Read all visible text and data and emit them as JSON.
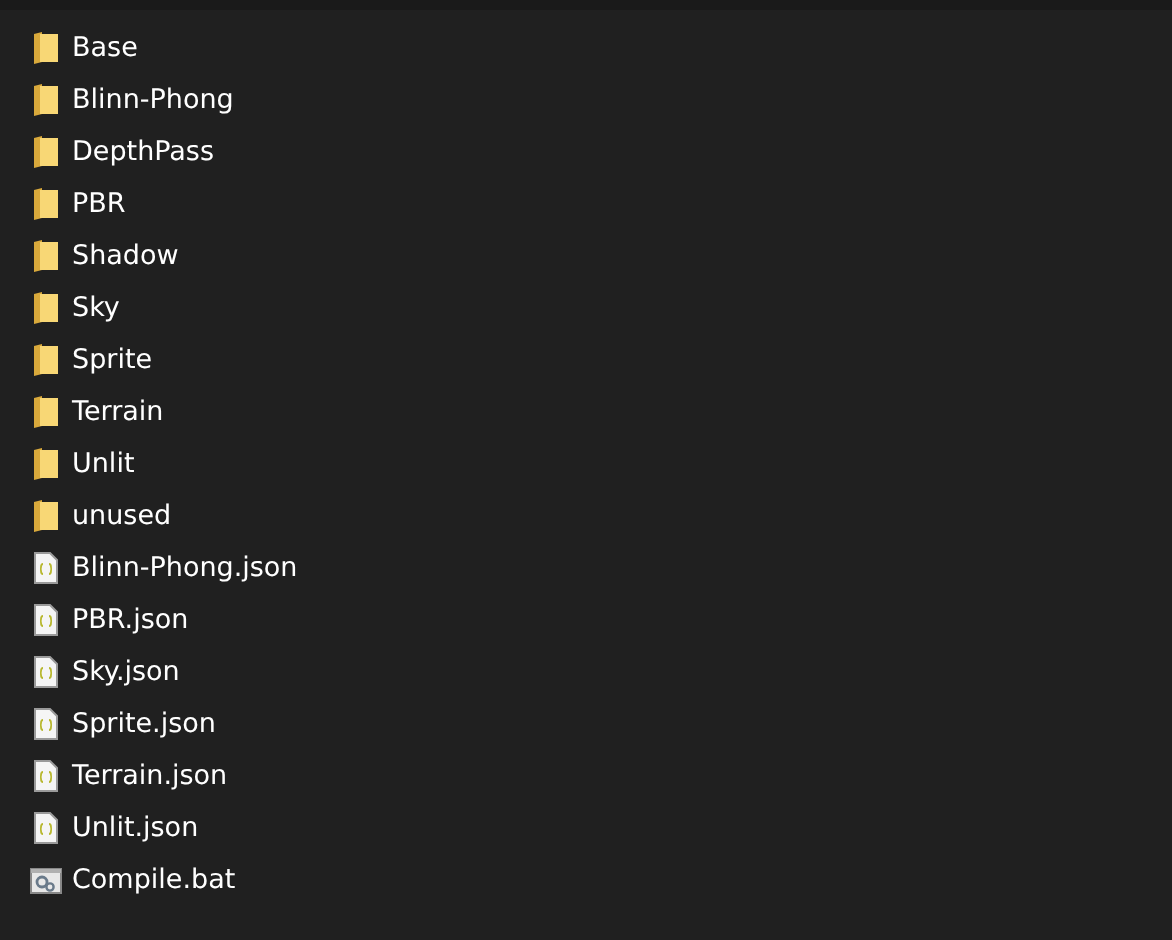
{
  "items": [
    {
      "name": "Base",
      "kind": "folder"
    },
    {
      "name": "Blinn-Phong",
      "kind": "folder"
    },
    {
      "name": "DepthPass",
      "kind": "folder"
    },
    {
      "name": "PBR",
      "kind": "folder"
    },
    {
      "name": "Shadow",
      "kind": "folder"
    },
    {
      "name": "Sky",
      "kind": "folder"
    },
    {
      "name": "Sprite",
      "kind": "folder"
    },
    {
      "name": "Terrain",
      "kind": "folder"
    },
    {
      "name": "Unlit",
      "kind": "folder"
    },
    {
      "name": "unused",
      "kind": "folder"
    },
    {
      "name": "Blinn-Phong.json",
      "kind": "json"
    },
    {
      "name": "PBR.json",
      "kind": "json"
    },
    {
      "name": "Sky.json",
      "kind": "json"
    },
    {
      "name": "Sprite.json",
      "kind": "json"
    },
    {
      "name": "Terrain.json",
      "kind": "json"
    },
    {
      "name": "Unlit.json",
      "kind": "json"
    },
    {
      "name": "Compile.bat",
      "kind": "bat"
    }
  ]
}
